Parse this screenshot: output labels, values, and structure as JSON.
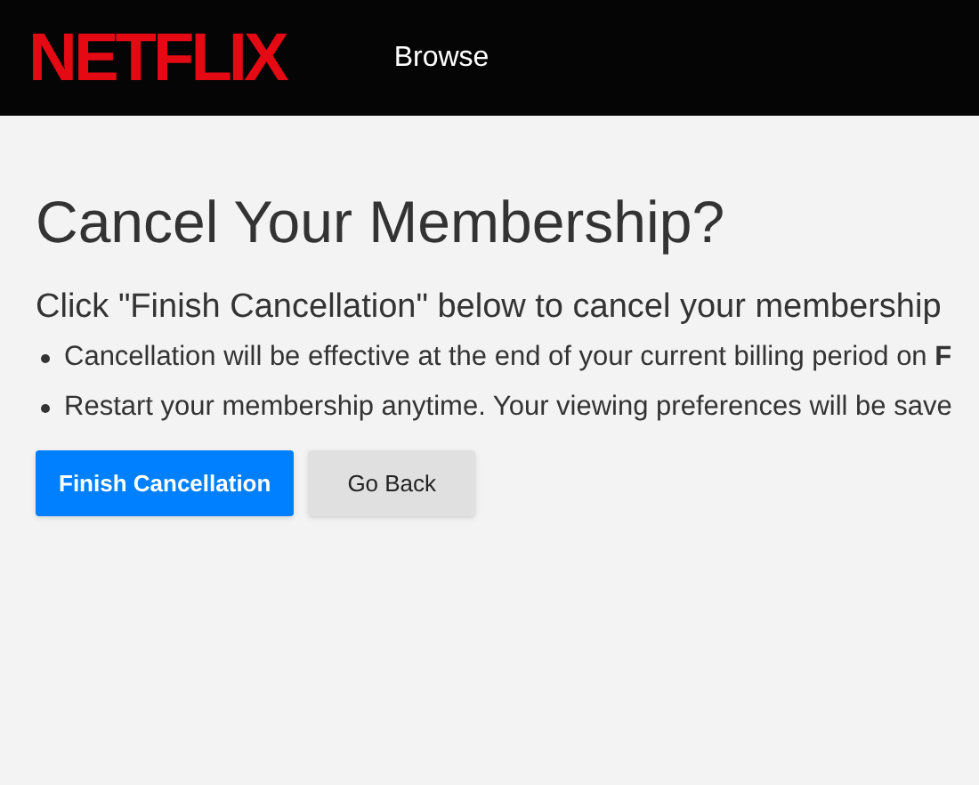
{
  "header": {
    "logo": "NETFLIX",
    "nav": [
      {
        "label": "Browse"
      }
    ]
  },
  "title": "Cancel Your Membership?",
  "subtitle": "Click \"Finish Cancellation\" below to cancel your membership",
  "bullets": [
    "Cancellation will be effective at the end of your current billing period on **F**",
    "Restart your membership anytime. Your viewing preferences will be save"
  ],
  "buttons": [
    {
      "label": "Finish Cancellation",
      "kind": "primary"
    },
    {
      "label": "Go Back",
      "kind": "secondary"
    }
  ]
}
